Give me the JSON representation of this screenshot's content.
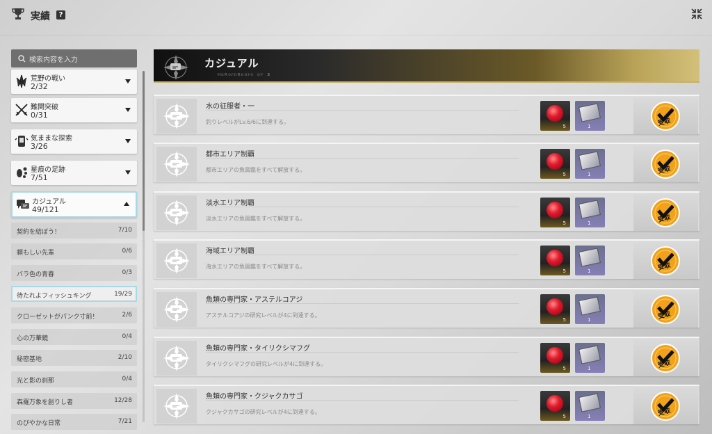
{
  "header": {
    "title": "実績",
    "help_label": "?"
  },
  "search": {
    "placeholder": "検索内容を入力"
  },
  "categories": [
    {
      "name": "荒野の戦い",
      "count": "2/32",
      "icon": "blades-icon"
    },
    {
      "name": "難関突破",
      "count": "0/31",
      "icon": "crossed-swords-icon"
    },
    {
      "name": "気ままな探索",
      "count": "3/26",
      "icon": "phone-icon"
    },
    {
      "name": "星痕の足跡",
      "count": "7/51",
      "icon": "footprint-icon"
    },
    {
      "name": "カジュアル",
      "count": "49/121",
      "icon": "chat-icon",
      "expanded": true
    }
  ],
  "subcategories": [
    {
      "name": "契約を結ぼう！",
      "count": "7/10"
    },
    {
      "name": "頼もしい先輩",
      "count": "0/6"
    },
    {
      "name": "バラ色の青春",
      "count": "0/3"
    },
    {
      "name": "待たれよフィッシュキング",
      "count": "19/29",
      "selected": true
    },
    {
      "name": "クローゼットがパンク寸前！",
      "count": "2/6"
    },
    {
      "name": "心の万華鏡",
      "count": "0/4"
    },
    {
      "name": "秘密基地",
      "count": "2/10"
    },
    {
      "name": "光と影の刹那",
      "count": "0/4"
    },
    {
      "name": "森羅万象を創りし者",
      "count": "12/28"
    },
    {
      "name": "のびやかな日常",
      "count": "7/21"
    }
  ],
  "banner": {
    "title": "カジュアル",
    "subtitle": "ʜᴋʀᴏᴘᴅʀᴋᴅᴘᴏ ᴅᴘ ʙ"
  },
  "achievements": [
    {
      "name": "水の征服者・一",
      "desc": "釣りレベルがLv.6/6に到達する。",
      "reward1": "5",
      "reward2": "1",
      "claim": "受取"
    },
    {
      "name": "都市エリア制覇",
      "desc": "都市エリアの魚図鑑をすべて解放する。",
      "reward1": "5",
      "reward2": "1",
      "claim": "受取"
    },
    {
      "name": "淡水エリア制覇",
      "desc": "淡水エリアの魚図鑑をすべて解放する。",
      "reward1": "5",
      "reward2": "1",
      "claim": "受取"
    },
    {
      "name": "海域エリア制覇",
      "desc": "海水エリアの魚図鑑をすべて解放する。",
      "reward1": "5",
      "reward2": "1",
      "claim": "受取"
    },
    {
      "name": "魚類の専門家・アステルコアジ",
      "desc": "アステルコアジの研究レベルが4に到達する。",
      "reward1": "5",
      "reward2": "1",
      "claim": "受取"
    },
    {
      "name": "魚類の専門家・タイリクシマフグ",
      "desc": "タイリクシマフグの研究レベルが4に到達する。",
      "reward1": "5",
      "reward2": "1",
      "claim": "受取"
    },
    {
      "name": "魚類の専門家・クジャクカサゴ",
      "desc": "クジャクカサゴの研究レベルが4に到達する。",
      "reward1": "5",
      "reward2": "1",
      "claim": "受取"
    }
  ],
  "colors": {
    "accent_border": "#a9d8e6",
    "banner_gold": "#c8b067",
    "gem_red": "#e01b2c",
    "badge_orange": "#f2a21a"
  }
}
